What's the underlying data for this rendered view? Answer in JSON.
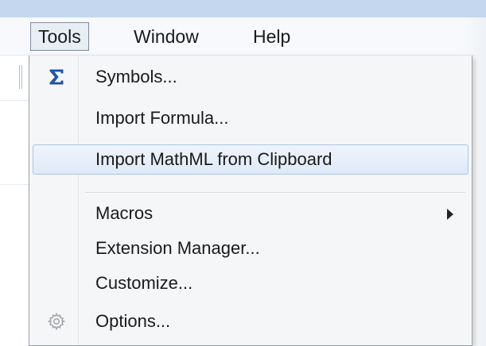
{
  "menubar": {
    "items": [
      {
        "label": "Tools",
        "active": true
      },
      {
        "label": "Window",
        "active": false
      },
      {
        "label": "Help",
        "active": false
      }
    ]
  },
  "tools_menu": {
    "items": [
      {
        "label": "Symbols...",
        "icon": "sigma-icon",
        "hover": false
      },
      {
        "label": "Import Formula...",
        "icon": "",
        "hover": false
      },
      {
        "label": "Import MathML from Clipboard",
        "icon": "",
        "hover": true
      },
      {
        "label": "Macros",
        "icon": "",
        "hover": false,
        "submenu": true
      },
      {
        "label": "Extension Manager...",
        "icon": "",
        "hover": false
      },
      {
        "label": "Customize...",
        "icon": "",
        "hover": false
      },
      {
        "label": "Options...",
        "icon": "gear-icon",
        "hover": false
      }
    ]
  },
  "colors": {
    "accent_sigma": "#1f5fbf",
    "hover_border": "#a9c5e6",
    "title_strip": "#c4d7ee"
  }
}
